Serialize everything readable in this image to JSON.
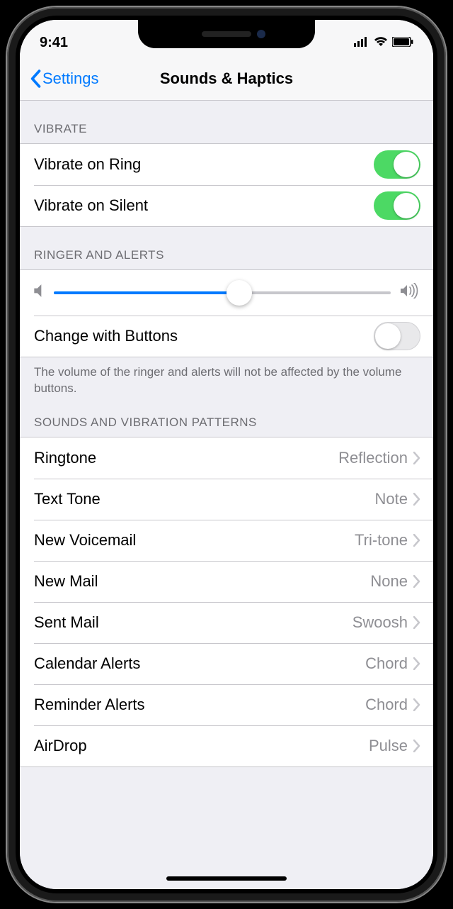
{
  "status": {
    "time": "9:41"
  },
  "nav": {
    "back_label": "Settings",
    "title": "Sounds & Haptics"
  },
  "vibrate": {
    "header": "VIBRATE",
    "ring": {
      "label": "Vibrate on Ring",
      "on": true
    },
    "silent": {
      "label": "Vibrate on Silent",
      "on": true
    }
  },
  "ringer": {
    "header": "RINGER AND ALERTS",
    "slider_value": 0.55,
    "change_buttons": {
      "label": "Change with Buttons",
      "on": false
    },
    "footer": "The volume of the ringer and alerts will not be affected by the volume buttons."
  },
  "patterns": {
    "header": "SOUNDS AND VIBRATION PATTERNS",
    "items": [
      {
        "label": "Ringtone",
        "value": "Reflection"
      },
      {
        "label": "Text Tone",
        "value": "Note"
      },
      {
        "label": "New Voicemail",
        "value": "Tri-tone"
      },
      {
        "label": "New Mail",
        "value": "None"
      },
      {
        "label": "Sent Mail",
        "value": "Swoosh"
      },
      {
        "label": "Calendar Alerts",
        "value": "Chord"
      },
      {
        "label": "Reminder Alerts",
        "value": "Chord"
      },
      {
        "label": "AirDrop",
        "value": "Pulse"
      }
    ]
  }
}
